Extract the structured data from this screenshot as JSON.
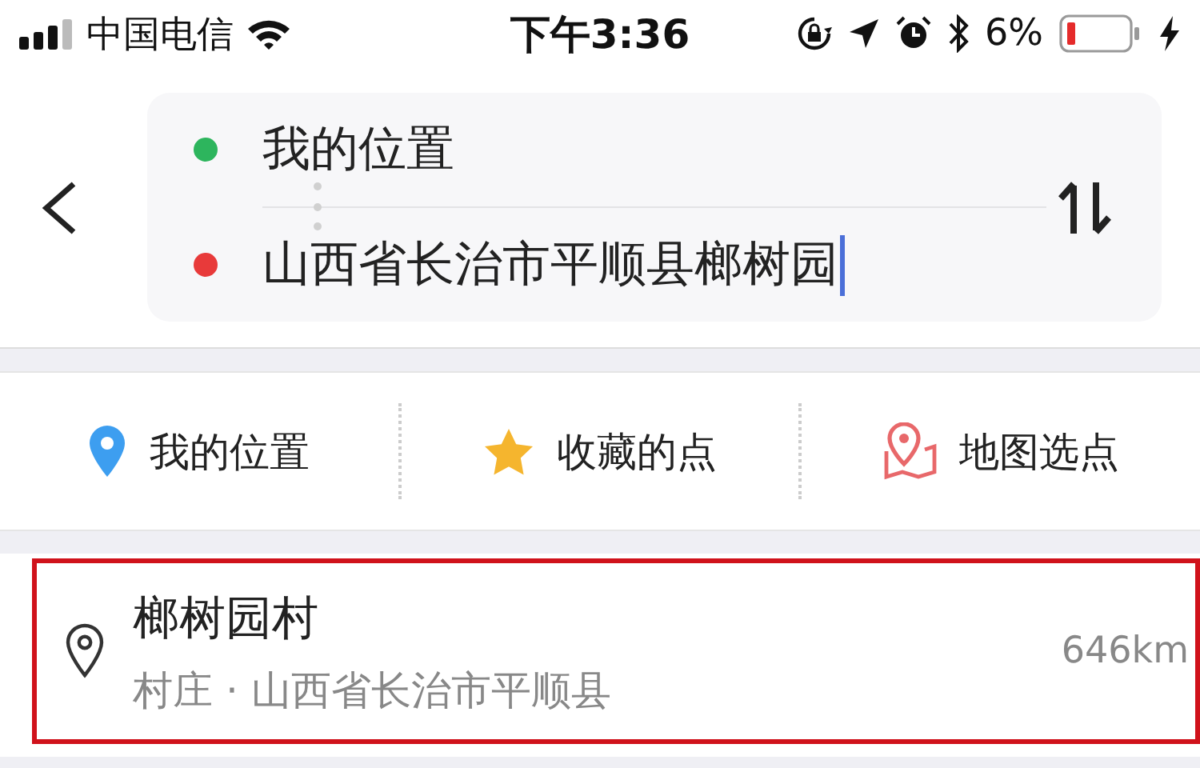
{
  "status_bar": {
    "carrier": "中国电信",
    "time": "下午3:36",
    "battery_text": "6%"
  },
  "route": {
    "origin": {
      "value": "我的位置",
      "color": "#2db55d"
    },
    "destination": {
      "value": "山西省长治市平顺县榔树园",
      "color": "#e83a3a",
      "focused": true
    }
  },
  "quick_actions": [
    {
      "kind": "location",
      "label": "我的位置"
    },
    {
      "kind": "favorite",
      "label": "收藏的点"
    },
    {
      "kind": "map",
      "label": "地图选点"
    }
  ],
  "results": [
    {
      "title": "榔树园村",
      "subtitle": "村庄 · 山西省长治市平顺县",
      "distance": "646km",
      "highlighted": true
    }
  ]
}
